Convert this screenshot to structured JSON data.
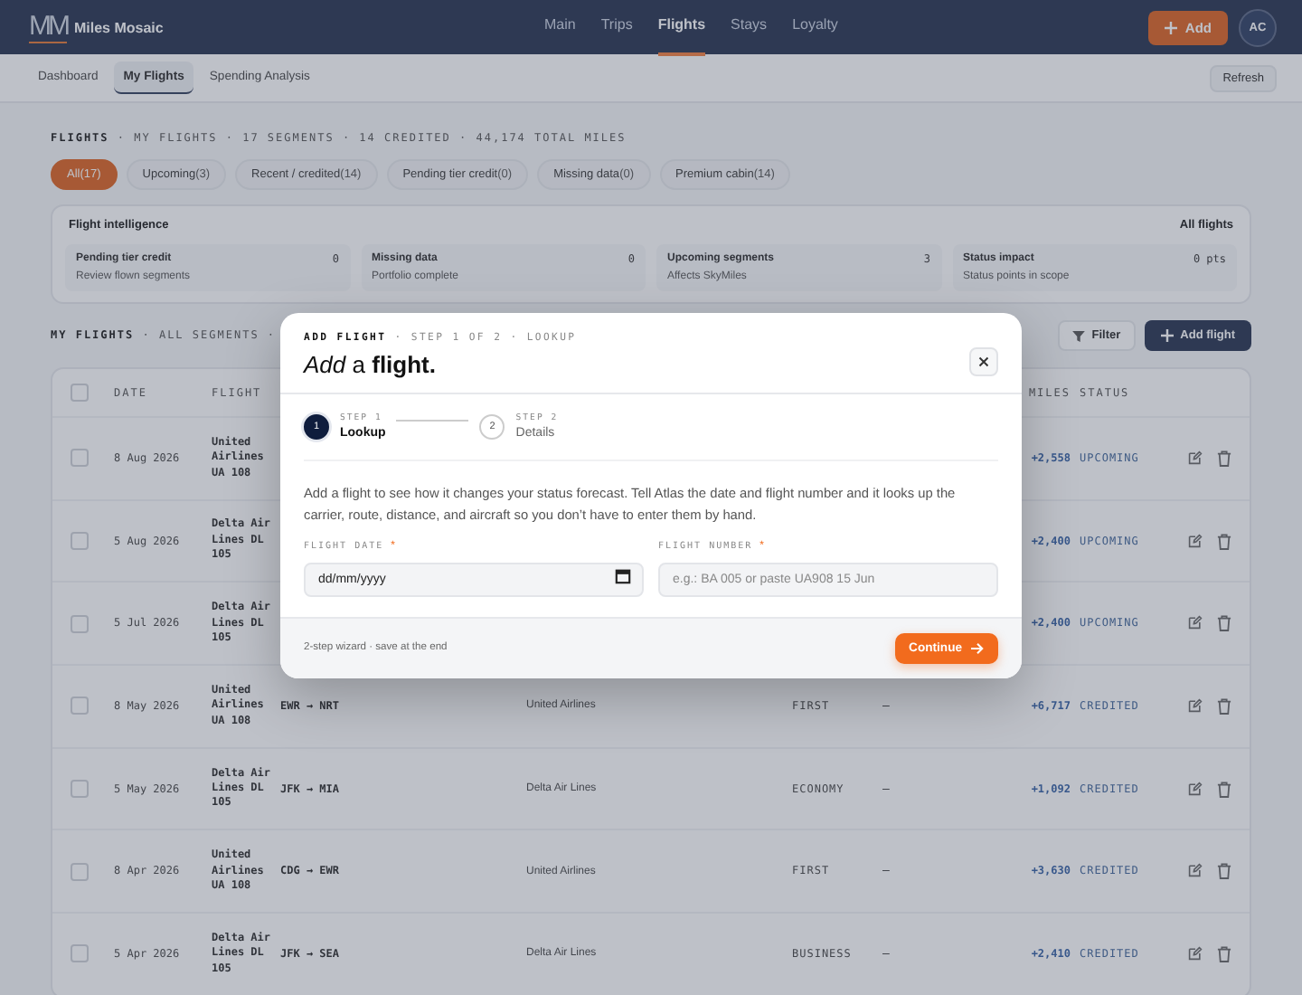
{
  "header": {
    "logo_mark": "MM",
    "brand": "Miles Mosaic",
    "nav": [
      {
        "label": "Main",
        "selected": false
      },
      {
        "label": "Trips",
        "selected": false
      },
      {
        "label": "Flights",
        "selected": true
      },
      {
        "label": "Stays",
        "selected": false
      },
      {
        "label": "Loyalty",
        "selected": false
      }
    ],
    "add_button": "Add",
    "avatar": "AC"
  },
  "subnav": {
    "tabs": [
      {
        "label": "Dashboard",
        "selected": false
      },
      {
        "label": "My Flights",
        "selected": true
      },
      {
        "label": "Spending Analysis",
        "selected": false
      }
    ],
    "refresh_button": "Refresh"
  },
  "breadcrumb": "**FLIGHTS** · MY FLIGHTS · 17 SEGMENTS · 14 CREDITED · 44,174 TOTAL MILES",
  "filters": [
    {
      "label": "All",
      "count": "(17)",
      "selected": true
    },
    {
      "label": "Upcoming",
      "count": "(3)",
      "selected": false
    },
    {
      "label": "Recent / credited",
      "count": "(14)",
      "selected": false
    },
    {
      "label": "Pending tier credit",
      "count": "(0)",
      "selected": false
    },
    {
      "label": "Missing data",
      "count": "(0)",
      "selected": false
    },
    {
      "label": "Premium cabin",
      "count": "(14)",
      "selected": false
    }
  ],
  "intelligence": {
    "title": "Flight intelligence",
    "scope": "All flights",
    "cards": [
      {
        "title": "Pending tier credit",
        "value": "0",
        "caption": "Review flown segments"
      },
      {
        "title": "Missing data",
        "value": "0",
        "caption": "Portfolio complete"
      },
      {
        "title": "Upcoming segments",
        "value": "3",
        "caption": "Affects SkyMiles"
      },
      {
        "title": "Status impact",
        "value": "0 pts",
        "caption": "Status points in scope"
      }
    ]
  },
  "flights_section": {
    "heading": "**MY FLIGHTS** · ALL SEGMENTS ·",
    "filter_button": "Filter",
    "add_button": "Add flight"
  },
  "table": {
    "select_all_checked": false,
    "columns": {
      "date": "DATE",
      "flight": "FLIGHT",
      "miles": "MILES",
      "status": "STATUS"
    },
    "rows": [
      {
        "checked": false,
        "date": "8 Aug 2026",
        "flight": "United Airlines UA 108",
        "miles": "+2,558",
        "status": "UPCOMING"
      },
      {
        "checked": false,
        "date": "5 Aug 2026",
        "flight": "Delta Air Lines DL 105",
        "miles": "+2,400",
        "status": "UPCOMING"
      },
      {
        "checked": false,
        "date": "5 Jul 2026",
        "flight": "Delta Air Lines DL 105",
        "miles": "+2,400",
        "status": "UPCOMING"
      },
      {
        "checked": false,
        "date": "8 May 2026",
        "flight": "United Airlines UA 108",
        "route": "EWR → NRT",
        "airline": "United Airlines",
        "cabin": "FIRST",
        "tier": "–",
        "miles": "+6,717",
        "status": "CREDITED"
      },
      {
        "checked": false,
        "date": "5 May 2026",
        "flight": "Delta Air Lines DL 105",
        "route": "JFK → MIA",
        "airline": "Delta Air Lines",
        "cabin": "ECONOMY",
        "tier": "–",
        "miles": "+1,092",
        "status": "CREDITED"
      },
      {
        "checked": false,
        "date": "8 Apr 2026",
        "flight": "United Airlines UA 108",
        "route": "CDG → EWR",
        "airline": "United Airlines",
        "cabin": "FIRST",
        "tier": "–",
        "miles": "+3,630",
        "status": "CREDITED"
      },
      {
        "checked": false,
        "date": "5 Apr 2026",
        "flight": "Delta Air Lines DL 105",
        "route": "JFK → SEA",
        "airline": "Delta Air Lines",
        "cabin": "BUSINESS",
        "tier": "–",
        "miles": "+2,410",
        "status": "CREDITED"
      }
    ]
  },
  "modal": {
    "eyebrow": "**ADD FLIGHT** · STEP 1 OF 2 · LOOKUP",
    "title": "*Add* a **flight.**",
    "steps": [
      {
        "number": "1",
        "eyebrow": "STEP 1",
        "label": "Lookup",
        "selected": true
      },
      {
        "number": "2",
        "eyebrow": "STEP 2",
        "label": "Details",
        "selected": false
      }
    ],
    "intro": "Add a flight to see how it changes your status forecast. Tell Atlas the date and flight number and it looks up the carrier, route, distance, and aircraft so you don’t have to enter them by hand.",
    "fields": [
      {
        "kind": "date",
        "label": "FLIGHT DATE",
        "required_mark": "*",
        "placeholder": "dd/mm/yyyy"
      },
      {
        "kind": "text",
        "label": "FLIGHT NUMBER",
        "required_mark": "*",
        "placeholder": "e.g.: BA 005 or paste UA908 15 Jun"
      }
    ],
    "footer_note": "2-step wizard · save at the end",
    "continue_button": "Continue"
  }
}
